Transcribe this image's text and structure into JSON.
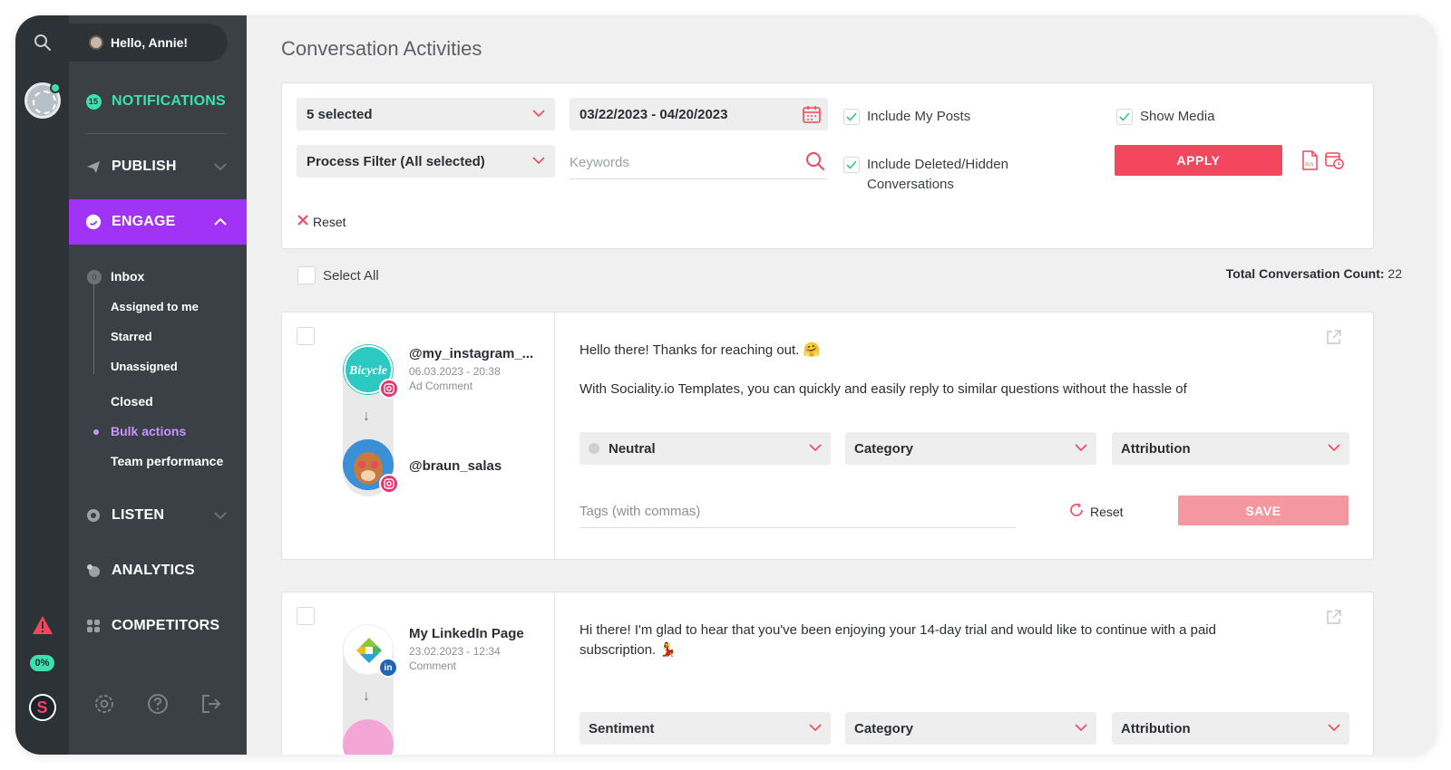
{
  "user": {
    "greeting": "Hello, Annie!"
  },
  "rail": {
    "usage_pct": "0%"
  },
  "sidebar": {
    "notifications": {
      "label": "NOTIFICATIONS",
      "count": "15"
    },
    "publish": "PUBLISH",
    "engage": "ENGAGE",
    "engage_items": {
      "inbox": "Inbox",
      "inbox_count": "0",
      "assigned": "Assigned to me",
      "starred": "Starred",
      "unassigned": "Unassigned",
      "closed": "Closed",
      "bulk": "Bulk actions",
      "team": "Team performance"
    },
    "listen": "LISTEN",
    "analytics": "ANALYTICS",
    "competitors": "COMPETITORS"
  },
  "page": {
    "title": "Conversation Activities"
  },
  "filters": {
    "accounts_selected": "5 selected",
    "process_filter": "Process Filter (All selected)",
    "date_range": "03/22/2023 - 04/20/2023",
    "keywords_placeholder": "Keywords",
    "include_my_posts": "Include My Posts",
    "include_deleted_line1": "Include Deleted/Hidden",
    "include_deleted_line2": "Conversations",
    "show_media": "Show Media",
    "apply": "APPLY",
    "reset": "Reset"
  },
  "list": {
    "select_all": "Select All",
    "total_label": "Total Conversation Count:",
    "total_value": "22"
  },
  "conversations": [
    {
      "handle": "@my_instagram_...",
      "datetime": "06.03.2023 - 20:38",
      "type": "Ad Comment",
      "reply_handle": "@braun_salas",
      "message_line1": "Hello there! Thanks for reaching out. 🤗",
      "message_line2": "With Sociality.io Templates, you can quickly and easily reply to similar questions without the hassle of",
      "sentiment": "Neutral",
      "category": "Category",
      "attribution": "Attribution",
      "tags_placeholder": "Tags (with commas)",
      "reset": "Reset",
      "save": "SAVE",
      "network": "instagram"
    },
    {
      "handle": "My LinkedIn Page",
      "datetime": "23.02.2023 - 12:34",
      "type": "Comment",
      "message_line1": "Hi there! I'm glad to hear that you've been enjoying your 14-day trial and would like to continue with a paid",
      "message_line2": "subscription. 💃",
      "sentiment": "Sentiment",
      "category": "Category",
      "attribution": "Attribution",
      "network": "linkedin",
      "network_badge": "in"
    }
  ],
  "colors": {
    "accent": "#a033f5",
    "apply": "#f2475c",
    "save": "#f5979f",
    "mint": "#3be1b0",
    "instagram": "#e8336e",
    "linkedin": "#1f66b5"
  }
}
